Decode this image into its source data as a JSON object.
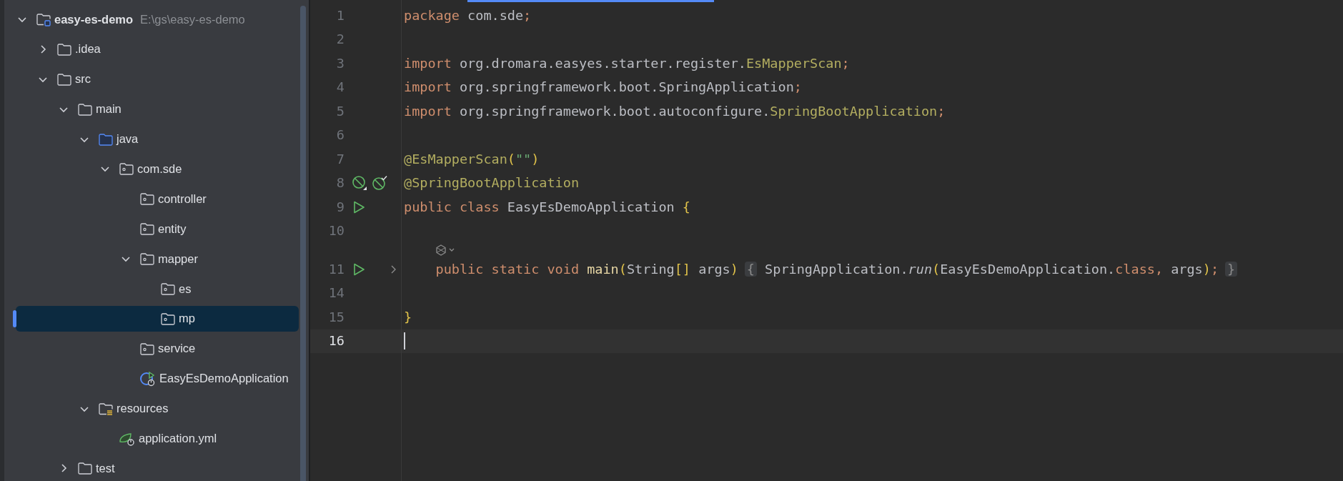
{
  "project_tree": {
    "items": [
      {
        "label": "easy-es-demo",
        "path": "E:\\gs\\easy-es-demo",
        "kind": "project",
        "expanded": true,
        "selected": false,
        "children": [
          {
            "label": ".idea",
            "kind": "folder",
            "expanded": false,
            "selected": false
          },
          {
            "label": "src",
            "kind": "folder",
            "expanded": true,
            "selected": false,
            "children": [
              {
                "label": "main",
                "kind": "folder",
                "expanded": true,
                "selected": false,
                "children": [
                  {
                    "label": "java",
                    "kind": "source",
                    "expanded": true,
                    "selected": false,
                    "children": [
                      {
                        "label": "com.sde",
                        "kind": "package",
                        "expanded": true,
                        "selected": false,
                        "children": [
                          {
                            "label": "controller",
                            "kind": "package",
                            "selected": false
                          },
                          {
                            "label": "entity",
                            "kind": "package",
                            "selected": false
                          },
                          {
                            "label": "mapper",
                            "kind": "package",
                            "expanded": true,
                            "selected": false,
                            "children": [
                              {
                                "label": "es",
                                "kind": "package",
                                "selected": false
                              },
                              {
                                "label": "mp",
                                "kind": "package",
                                "selected": true
                              }
                            ]
                          },
                          {
                            "label": "service",
                            "kind": "package",
                            "selected": false
                          },
                          {
                            "label": "EasyEsDemoApplication",
                            "kind": "spring-class",
                            "selected": false
                          }
                        ]
                      }
                    ]
                  },
                  {
                    "label": "resources",
                    "kind": "resources",
                    "expanded": true,
                    "selected": false,
                    "children": [
                      {
                        "label": "application.yml",
                        "kind": "spring-config",
                        "selected": false
                      }
                    ]
                  }
                ]
              },
              {
                "label": "test",
                "kind": "folder",
                "expanded": false,
                "selected": false
              }
            ]
          }
        ]
      }
    ]
  },
  "editor": {
    "lines": [
      {
        "number": "1",
        "tokens": [
          {
            "text": "package",
            "kind": "keyword"
          },
          {
            "text": " com.sde",
            "kind": "plain"
          },
          {
            "text": ";",
            "kind": "keyword"
          }
        ]
      },
      {
        "number": "2"
      },
      {
        "number": "3",
        "tokens": [
          {
            "text": "import",
            "kind": "keyword"
          },
          {
            "text": " org.dromara.easyes.starter.register.",
            "kind": "plain"
          },
          {
            "text": "EsMapperScan",
            "kind": "annotation"
          },
          {
            "text": ";",
            "kind": "keyword"
          }
        ]
      },
      {
        "number": "4",
        "tokens": [
          {
            "text": "import",
            "kind": "keyword"
          },
          {
            "text": " org.springframework.boot.",
            "kind": "plain"
          },
          {
            "text": "SpringApplication",
            "kind": "plain"
          },
          {
            "text": ";",
            "kind": "keyword"
          }
        ]
      },
      {
        "number": "5",
        "tokens": [
          {
            "text": "import",
            "kind": "keyword"
          },
          {
            "text": " org.springframework.boot.autoconfigure.",
            "kind": "plain"
          },
          {
            "text": "SpringBootApplication",
            "kind": "annotation"
          },
          {
            "text": ";",
            "kind": "keyword"
          }
        ]
      },
      {
        "number": "6"
      },
      {
        "number": "7",
        "tokens": [
          {
            "text": "@EsMapperScan",
            "kind": "annotation"
          },
          {
            "text": "(",
            "kind": "bracket"
          },
          {
            "text": "\"\"",
            "kind": "string"
          },
          {
            "text": ")",
            "kind": "bracket"
          }
        ]
      },
      {
        "number": "8",
        "gutter": [
          {
            "kind": "bean"
          },
          {
            "kind": "bean-check"
          }
        ],
        "tokens": [
          {
            "text": "@SpringBootApplication",
            "kind": "annotation"
          }
        ]
      },
      {
        "number": "9",
        "gutter": [
          {
            "kind": "run"
          }
        ],
        "tokens": [
          {
            "text": "public class",
            "kind": "keyword"
          },
          {
            "text": " EasyEsDemoApplication ",
            "kind": "plain"
          },
          {
            "text": "{",
            "kind": "bracket"
          }
        ]
      },
      {
        "number": "10"
      },
      {
        "number": "11",
        "hint": true,
        "gutter": [
          {
            "kind": "run"
          }
        ],
        "foldable": true,
        "tokens": [
          {
            "text": "    public static void",
            "kind": "keyword"
          },
          {
            "text": " main",
            "kind": "method"
          },
          {
            "text": "(",
            "kind": "bracket"
          },
          {
            "text": "String",
            "kind": "plain"
          },
          {
            "text": "[]",
            "kind": "bracket"
          },
          {
            "text": " args",
            "kind": "plain"
          },
          {
            "text": ")",
            "kind": "bracket"
          },
          {
            "text": "{",
            "kind": "fold"
          },
          {
            "text": " SpringApplication.",
            "kind": "plain"
          },
          {
            "text": "run",
            "kind": "italic"
          },
          {
            "text": "(",
            "kind": "bracket"
          },
          {
            "text": "EasyEsDemoApplication.",
            "kind": "plain"
          },
          {
            "text": "class,",
            "kind": "keyword"
          },
          {
            "text": " args",
            "kind": "plain"
          },
          {
            "text": ")",
            "kind": "bracket"
          },
          {
            "text": ";",
            "kind": "keyword"
          },
          {
            "text": "}",
            "kind": "fold"
          }
        ]
      },
      {
        "number": "14"
      },
      {
        "number": "15",
        "tokens": [
          {
            "text": "}",
            "kind": "bracket"
          }
        ]
      },
      {
        "number": "16",
        "current": true
      }
    ]
  }
}
